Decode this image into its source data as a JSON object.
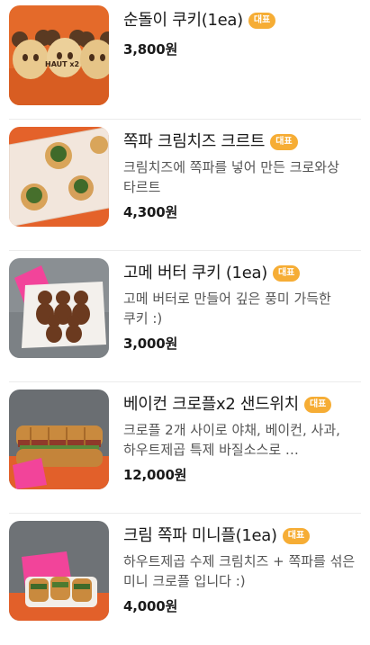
{
  "menu": {
    "items": [
      {
        "name": "순돌이 쿠키(1ea)",
        "badge": "대표",
        "description": "",
        "price": "3,800원",
        "image_text": "HAUT x2"
      },
      {
        "name": "쪽파 크림치즈 크르트",
        "badge": "대표",
        "description": "크림치즈에 쪽파를 넣어 만든 크로와상 타르트",
        "price": "4,300원"
      },
      {
        "name": "고메 버터 쿠키 (1ea)",
        "badge": "대표",
        "description": "고메 버터로 만들어 깊은 풍미 가득한 쿠키 :)",
        "price": "3,000원"
      },
      {
        "name": "베이컨 크로플x2 샌드위치",
        "badge": "대표",
        "description": "크로플 2개 사이로 야채, 베이컨, 사과, 하우트제곱 특제 바질소스로 …",
        "price": "12,000원"
      },
      {
        "name": "크림 쪽파 미니플(1ea)",
        "badge": "대표",
        "description": "하우트제곱 수제 크림치즈 + 쪽파를 섞은 미니 크로플 입니다 :)",
        "price": "4,000원"
      }
    ]
  }
}
